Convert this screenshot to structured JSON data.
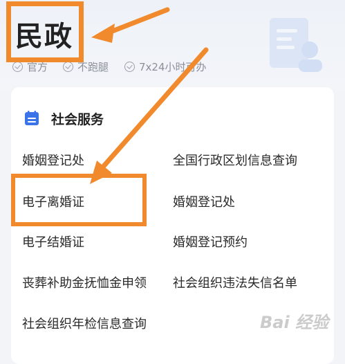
{
  "header": {
    "title": "民政",
    "tags": [
      "官方",
      "不跑腿",
      "7x24小时可办"
    ]
  },
  "section": {
    "title": "社会服务",
    "items": [
      "婚姻登记处",
      "全国行政区划信息查询",
      "电子离婚证",
      "婚姻登记处",
      "电子结婚证",
      "婚姻登记预约",
      "丧葬补助金抚恤金申领",
      "社会组织违法失信名单",
      "社会组织年检信息查询"
    ]
  },
  "watermark": "Bai 经验",
  "colors": {
    "annotation": "#f08a2c",
    "section_icon": "#3b73e8",
    "background": "#f2f4f8"
  }
}
